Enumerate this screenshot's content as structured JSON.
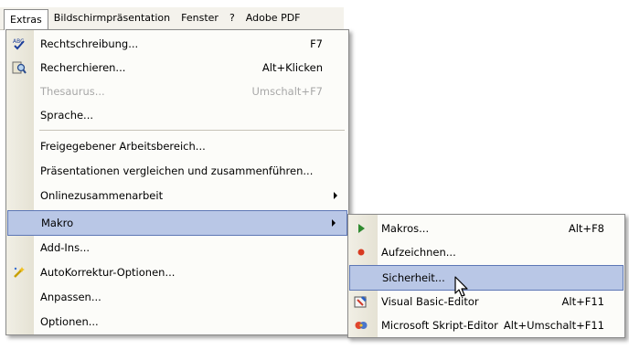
{
  "menubar": {
    "items": [
      "Extras",
      "Bildschirmpräsentation",
      "Fenster",
      "?",
      "Adobe PDF"
    ]
  },
  "main_menu": {
    "items": [
      {
        "label": "Rechtschreibung...",
        "shortcut": "F7",
        "icon": "spellcheck-icon"
      },
      {
        "label": "Recherchieren...",
        "shortcut": "Alt+Klicken",
        "icon": "research-icon"
      },
      {
        "label": "Thesaurus...",
        "shortcut": "Umschalt+F7",
        "disabled": true
      },
      {
        "label": "Sprache..."
      },
      {
        "label": "Freigegebener Arbeitsbereich..."
      },
      {
        "label": "Präsentationen vergleichen und zusammenführen..."
      },
      {
        "label": "Onlinezusammenarbeit",
        "submenu": true
      },
      {
        "label": "Makro",
        "submenu": true,
        "highlighted": true
      },
      {
        "label": "Add-Ins..."
      },
      {
        "label": "AutoKorrektur-Optionen...",
        "icon": "autocorrect-icon"
      },
      {
        "label": "Anpassen..."
      },
      {
        "label": "Optionen..."
      }
    ]
  },
  "sub_menu": {
    "items": [
      {
        "label": "Makros...",
        "shortcut": "Alt+F8",
        "icon": "play-icon"
      },
      {
        "label": "Aufzeichnen...",
        "icon": "record-icon"
      },
      {
        "label": "Sicherheit...",
        "highlighted": true
      },
      {
        "label": "Visual Basic-Editor",
        "shortcut": "Alt+F11",
        "icon": "vb-editor-icon"
      },
      {
        "label": "Microsoft Skript-Editor",
        "shortcut": "Alt+Umschalt+F11",
        "icon": "script-editor-icon"
      }
    ]
  },
  "colors": {
    "highlight": "#b9c7e6",
    "highlight_border": "#5d77b5"
  }
}
